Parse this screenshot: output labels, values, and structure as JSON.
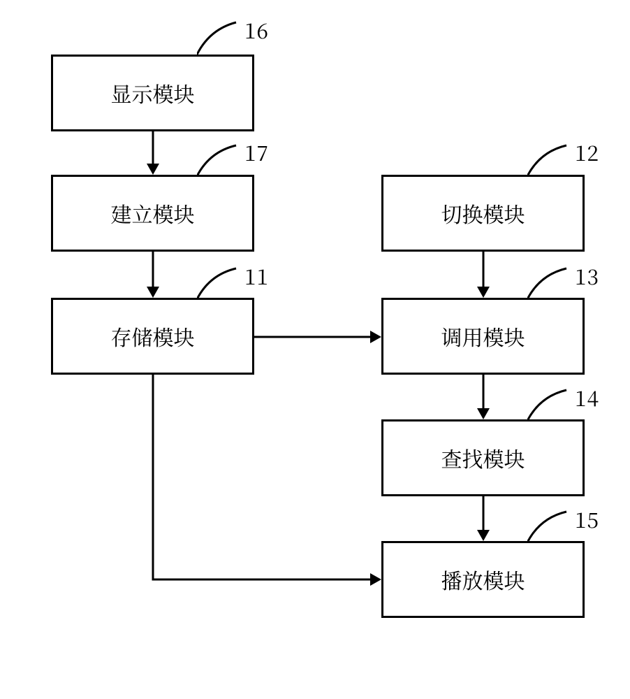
{
  "nodes": {
    "n16": {
      "num": "16",
      "text": "显示模块"
    },
    "n17": {
      "num": "17",
      "text": "建立模块"
    },
    "n11": {
      "num": "11",
      "text": "存储模块"
    },
    "n12": {
      "num": "12",
      "text": "切换模块"
    },
    "n13": {
      "num": "13",
      "text": "调用模块"
    },
    "n14": {
      "num": "14",
      "text": "查找模块"
    },
    "n15": {
      "num": "15",
      "text": "播放模块"
    }
  }
}
